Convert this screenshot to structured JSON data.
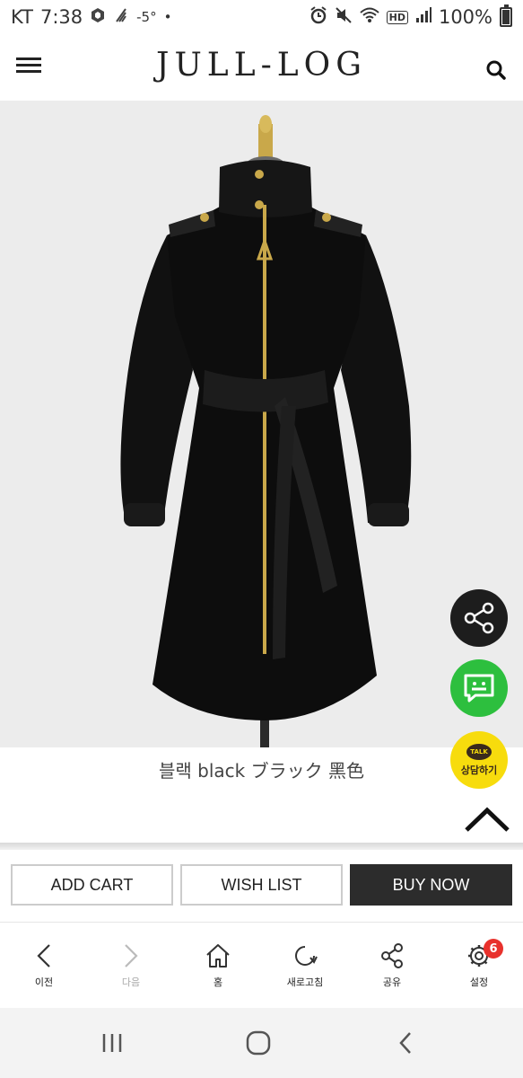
{
  "status_bar": {
    "carrier": "KT",
    "time": "7:38",
    "temperature": "-5°",
    "network_badge": "HD",
    "battery": "100%"
  },
  "header": {
    "logo": "JULL-LOG",
    "menu_icon": "hamburger-icon",
    "search_icon": "search-icon"
  },
  "product": {
    "caption": "블랙  black ブラック 黑色"
  },
  "floating": {
    "share_icon": "share-icon",
    "chat_icon": "chat-icon",
    "talk_badge": "TALK",
    "talk_label": "상담하기"
  },
  "actions": {
    "add_cart": "ADD CART",
    "wish_list": "WISH LIST",
    "buy_now": "BUY NOW"
  },
  "browser_bar": {
    "items": [
      {
        "label": "이전",
        "icon": "back-icon"
      },
      {
        "label": "다음",
        "icon": "forward-icon"
      },
      {
        "label": "홈",
        "icon": "home-icon"
      },
      {
        "label": "새로고침",
        "icon": "refresh-icon"
      },
      {
        "label": "공유",
        "icon": "share-icon"
      },
      {
        "label": "설정",
        "icon": "gear-icon",
        "badge": "6"
      }
    ]
  },
  "colors": {
    "share_button": "#1d1d1d",
    "chat_button": "#2dbf3e",
    "talk_button": "#f7dc0d",
    "buy_button": "#2c2c2c",
    "badge": "#e8312c"
  }
}
